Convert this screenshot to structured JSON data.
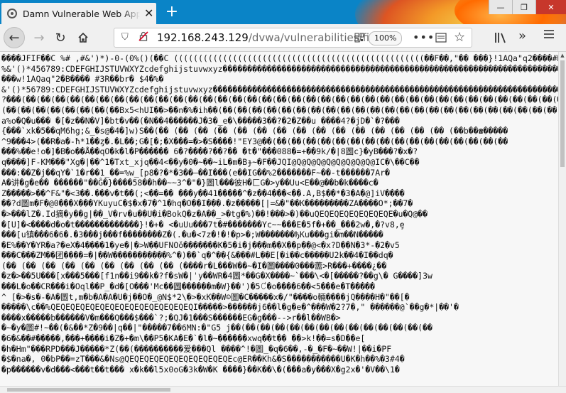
{
  "browser": {
    "tab_title": "Damn Vulnerable Web App",
    "url_host": "192.168.243.129",
    "url_path": "/dvwa/vulnerabilities/fi/",
    "zoom": "100%"
  },
  "content": {
    "lines": [
      "����JFIF��C  %#  ,#&')*)-0-(0%()(��C  (((((((((((((((((((((((((((((((((((((((((((((((((((��F��,\"��  ���}!1AQa\"q2����#B���R��$3br��",
      "%&'()*456789:CDEFGHIJSTUVWXYZcdefghijstuvwxyz��������������������������������������������������������������������������������",
      " ���w!1AQaq\"2�B����  #3R��br� $4�%�",
      "&'()*56789:CDEFGHIJSTUVWXYZcdefghijstuvwxyz�������������������������������������������������������������������������������",
      "?���(��(��(��(��(��(��(��(��(��(��(��(��(��(��(��(��(��(��(��(��(��(��(��(��(��(��(��(��(��(��(��(��(��(��(��(��(��(��(��(��",
      "(��(��(��(��(��(��(��(��Bx5<hUI��>��n�%�ih��(��(��(��(��(��(��(��(��(��(��(��(��(��(��(��(��(��(��(��(��(��(��(��(��(��(��",
      "a%o�Q�u��� �[�z��N�V]�bt�v��(�N��4������J�3�_e�\\�����3��?�2�Z��u ����4?�jD�`�?���",
      "{���`xk�5��qM6hg;&_�s@�4�]w)S��(�� (�� (�� (�� (�� (�� (�� (�� (�� (�� (�� (�� (�� (�� (�� (��b��☎�����",
      "^9���4>(��R�a�-ħ*1��ȥ�.�L��;G�[�;�X���=�>�S����!\"EY3@��(��(��(��(��(��(��(��(��(��(��(��(��(��(��(��(��",
      "���%��e!o�]�B�o��Å��qO�k�l�P������  6�?����?��?��  �t�\"���088�=+��9k/�|8圖c}�yB���?�x�?",
      "q����]F-KM���\"Xg�|��^1�Txt_xjq��4<��y�0�~��~iL�m�Bɟ~�F��JQI@Q@Q@Q@Q@Q@Q@Q@Q@IC�\\��C��",
      "���:��Z�j��qY�`1�r��1_��=%w_[p8�?�*�3��—��I���(e��IG��%2�������F~��-t������7Ar�",
      "A�讲�g�e�� ������\"��Ĝ�}����58��h��~~3^�\"�}圖l���彼H�匚G�>y��Uu<E��@��b�k����c�",
      "Z�����>��^F&\"�<3��.���v�t��(;<��=��  ���y��41�����^�z��4��ٛ�<��.A,B$��*�3�A�@]iV����",
      "��?d圖m�F�@0���X���YKuyuC�$�x�7�^1�hq�O��I���.�z�����[|=&�\"��K���������ZA����O*;��7�",
      "�>���lZ�.Id摘�y��g|��_V�rv�u��U�i�BokQ�z�A��_>�tg�%)��!���>�)��uQEQEQEQEQEQEQEQE�u�Q@��",
      "�[U]�<����d�o�t�������������}!�+� <�uUu���7t�#�������Yc~~���E�5f�+��_���2w�,�?v8,ȩ",
      "���[u镇���6�6�.�3���j���f��������Z�(.�u�<7z�!�!�p>�;W�������ђKu���gi�m��N�����",
      "�E%��Y�YR�a?�eX�4����1�ye�|�>W��UFNOǒ�������K�5�i�j���m��X��p��@<�x?D��N�3*-�2�v5",
      "���C���ZM��团����=�|��W�����������%^�)��`q�^��{&���#L��E[�i��c�����U2k��4�I��dq�",
      "(�� (�� (�� (�� (�� (�� (�� (�� (�� (����r�L���W��~�I�圖����0���蘦>R���+����¿��",
      "�z�>��5U���[x���5���[f1n��i9��k�?f�sW�|ˈy��WR�4圖*��G�X����~`���\\<�[�����?��g\\� G����]3w",
      "���L�o��CR���i�Oql��P_�d�[O���'Mc��圖������m�W}��')�5꒝�o����6��<5���e�T�����",
      "^ [�>�s�-�A�圖t,m�b�A�A�U�j��O�_@N$*2\\�>�xK��W☺圖�C�����x�/\"����o輛����jQ����H�\"��[�",
      "�����\\c��%QEQEQEQEQEQEQEQEQEQEQEQEQEQEQI�����>������j6��l�g�e�^���W�2?7�,\" ������@`��g�*|��'�",
      "����x�����b������V�m���Q���$���`?;�QJ�1���S������EG�g���-->r��l��WB�>",
      "�~�y�圖#!~��(�&��*Z�9��|q��|\"�����7��6MN:�\"G5 j��(��(��(��(��(��(��(��(��(��(��(��(��(��",
      "�6�&��#�����,���+����i�Z�+�m\\��P5�KA�E�`�l�~������xwq��t�� ��>k!��=s�D��e[",
      "�h�Hm\"���RPD���J�����*Z(��(����������爱���Ql ����^!�圖_�q�6��,-�_�F�~��W!|��i�PF",
      "�$�na�, 0�bP��=zT���&�Ns@QEQEQEQEQEQEQEQEQEQEQEc@ER��Kh&�S�����������U�K�h��%�3#4�",
      "�p������v�d���<���t��t��� x�k��l5x0oG�3k�W�K ����}��K��\\�(���a�y���X�g2x�'�V��\\1�"
    ]
  }
}
